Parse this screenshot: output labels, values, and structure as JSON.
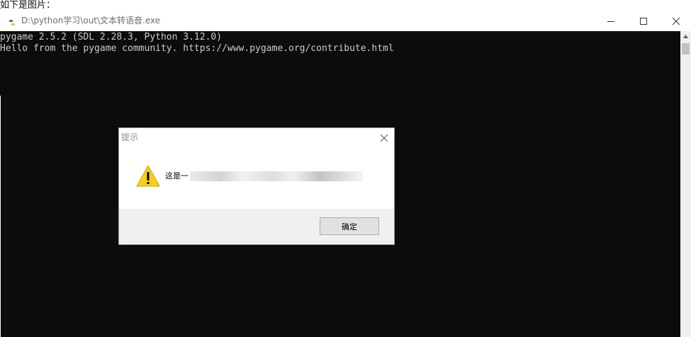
{
  "caption": "如下是图片：",
  "window": {
    "title": "D:\\python学习\\out\\文本转语音.exe",
    "app_icon": "python-icon",
    "controls": [
      "minimize-icon",
      "maximize-icon",
      "close-icon"
    ]
  },
  "console": {
    "lines": [
      "pygame 2.5.2 (SDL 2.28.3, Python 3.12.0)",
      "Hello from the pygame community. https://www.pygame.org/contribute.html"
    ]
  },
  "dialog": {
    "title": "提示",
    "icon": "warning-icon",
    "message": "这是一",
    "ok_label": "确定"
  },
  "colors": {
    "console_bg": "#0c0c0c",
    "console_text": "#cccccc",
    "dialog_footer": "#f0f0f0",
    "warning_yellow": "#f7d117"
  }
}
